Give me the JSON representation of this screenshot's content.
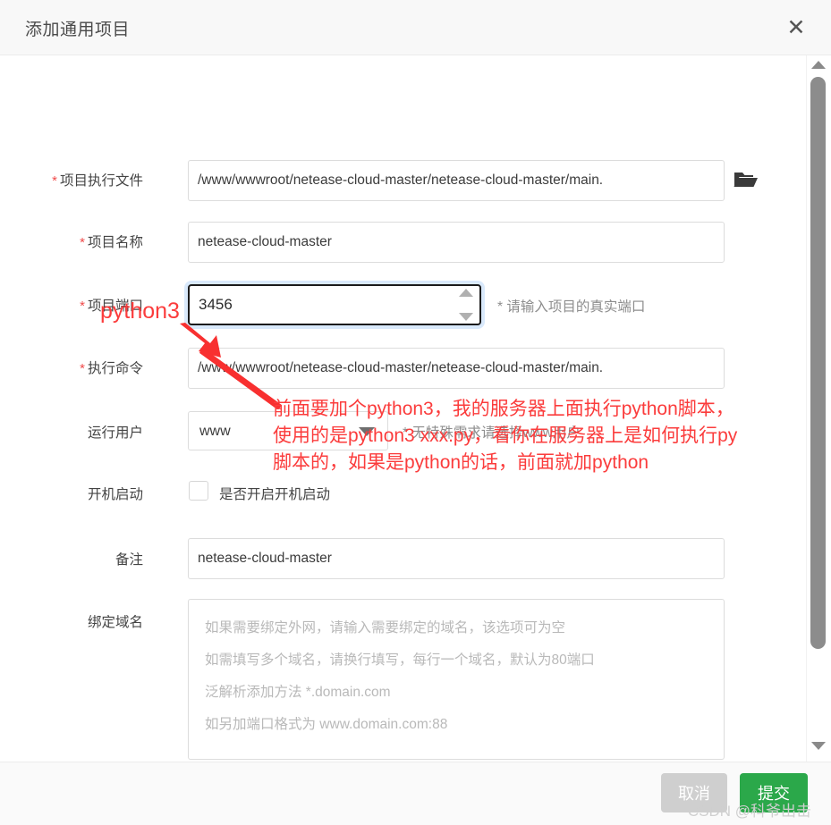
{
  "dialog": {
    "title": "添加通用项目",
    "close_icon": "close-icon"
  },
  "form": {
    "exec_file": {
      "label": "项目执行文件",
      "required_mark": "*",
      "value": "/www/wwwroot/netease-cloud-master/netease-cloud-master/main.",
      "browse_icon": "folder-icon"
    },
    "project_name": {
      "label": "项目名称",
      "required_mark": "*",
      "value": "netease-cloud-master"
    },
    "project_port": {
      "label": "项目端口",
      "required_mark": "*",
      "value": "3456",
      "hint": "* 请输入项目的真实端口"
    },
    "exec_command": {
      "label": "执行命令",
      "required_mark": "*",
      "value": "/www/wwwroot/netease-cloud-master/netease-cloud-master/main."
    },
    "run_user": {
      "label": "运行用户",
      "value": "www",
      "hint": "* 无特殊需求请选择www用户",
      "options": [
        "www"
      ]
    },
    "boot_start": {
      "label": "开机启动",
      "checkbox_label": "是否开启开机启动",
      "checked": false
    },
    "remark": {
      "label": "备注",
      "value": "netease-cloud-master"
    },
    "bind_domain": {
      "label": "绑定域名",
      "value": "",
      "placeholder_lines": [
        "如果需要绑定外网，请输入需要绑定的域名，该选项可为空",
        "如需填写多个域名，请换行填写，每行一个域名，默认为80端口",
        "泛解析添加方法 *.domain.com",
        "如另加端口格式为 www.domain.com:88"
      ]
    }
  },
  "footer": {
    "cancel_label": "取消",
    "submit_label": "提交"
  },
  "annotations": {
    "color": "#fb3c3c",
    "inline_python3": "python3",
    "note_line1": "前面要加个python3，我的服务器上面执行python脚本，",
    "note_line2": "使用的是python3 xxx.py，看你在服务器上是如何执行py",
    "note_line3": "脚本的，如果是python的话，前面就加python"
  },
  "watermark": "CSDN @科爷出击",
  "scrollbar": {
    "up_icon": "chevron-up-icon",
    "down_icon": "chevron-down-icon"
  }
}
